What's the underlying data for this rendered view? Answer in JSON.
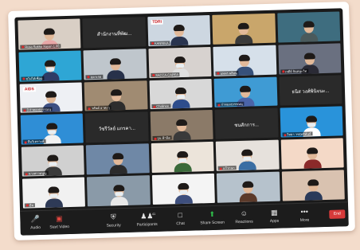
{
  "tiles": [
    {
      "kind": "person",
      "bg": "#d9cfc5",
      "torso": "#e8a7a7",
      "name": "Rusa Sokha Sayan 1.00"
    },
    {
      "kind": "text",
      "bg": "#2a2a2a",
      "label": "สำนักงานที่พัฒ..."
    },
    {
      "kind": "person",
      "bg": "#cdd7e1",
      "torso": "#29344f",
      "name": "KANNIKA",
      "tag": "TDRI",
      "tag_color": "red"
    },
    {
      "kind": "person",
      "bg": "#c9a66b",
      "torso": "#3a3a3a",
      "name": ""
    },
    {
      "kind": "person",
      "bg": "#3e6d7f",
      "torso": "#4a5a5c",
      "name": ""
    },
    {
      "kind": "person",
      "bg": "#2ea6d5",
      "torso": "#2e3c66",
      "name": "ชไม่ได้เชื่อม",
      "mask": true
    },
    {
      "kind": "person",
      "bg": "#bfc6cc",
      "torso": "#27314a",
      "name": "ฤดาเรต"
    },
    {
      "kind": "person",
      "bg": "#d7d2cf",
      "torso": "#e0e0e0",
      "name": "SACCA-CAPEA",
      "mask": true
    },
    {
      "kind": "person",
      "bg": "#d6e0ea",
      "torso": "#37517a",
      "name": "นพพร ผลิอนุ"
    },
    {
      "kind": "person",
      "bg": "#6a7080",
      "torso": "#2a2a35",
      "name": "เจดีย์ จินทนะวิท"
    },
    {
      "kind": "person",
      "bg": "#eef0f4",
      "torso": "#3d4f82",
      "name": "3 ก่าตองสุวรรณนุ",
      "tag": "AIDS"
    },
    {
      "kind": "person",
      "bg": "#a08b72",
      "torso": "#2d2d2d",
      "name": "วสันต์ อาคะวุ"
    },
    {
      "kind": "person",
      "bg": "#d8d8d8",
      "torso": "#2e4d8c",
      "name": "Chalinee",
      "mask": true
    },
    {
      "kind": "person",
      "bg": "#3f9bd4",
      "torso": "#4b64a8",
      "name": "ก่าตองสุวรรณนุ"
    },
    {
      "kind": "text",
      "bg": "#2a2a2a",
      "label": "ธนิส วงศ์พินิจนะ..."
    },
    {
      "kind": "person",
      "bg": "#2f8ed6",
      "torso": "#f2f2f2",
      "name": "ทีมวิเคราะห์",
      "mask": true
    },
    {
      "kind": "text",
      "bg": "#2a2a2a",
      "label": "วัชรีวัลย์ แกรคา..."
    },
    {
      "kind": "person",
      "bg": "#8b7a68",
      "torso": "#3a3a3a",
      "name": "จูน ฟ้านิด"
    },
    {
      "kind": "text",
      "bg": "#2a2a2a",
      "label": "ชนสักการ..."
    },
    {
      "kind": "person",
      "bg": "#2993da",
      "torso": "#ffffff",
      "name": "วิทยา วรสุทธิพันธ์",
      "mask": true
    },
    {
      "kind": "person",
      "bg": "#d0d0d0",
      "torso": "#3a3a3a",
      "name": "นางสาวมนูญ",
      "mask": true
    },
    {
      "kind": "person",
      "bg": "#6f88a6",
      "torso": "#2b2b2b",
      "name": ""
    },
    {
      "kind": "person",
      "bg": "#ece4da",
      "torso": "#3a6a3a",
      "name": "",
      "mask": true
    },
    {
      "kind": "person",
      "bg": "#e6e1dc",
      "torso": "#3b6ea3",
      "name": "แก้วกนก",
      "mask": true
    },
    {
      "kind": "person",
      "bg": "#f4d9c7",
      "torso": "#8b2a2a",
      "name": ""
    },
    {
      "kind": "person",
      "bg": "#f1f1f1",
      "torso": "#2e3a56",
      "name": "มีช",
      "mask": true
    },
    {
      "kind": "person",
      "bg": "#8a9aa8",
      "torso": "#e8e8e8",
      "name": "",
      "mask": true
    },
    {
      "kind": "person",
      "bg": "#f4f4f4",
      "torso": "#3e4f7d",
      "name": "",
      "mask": true
    },
    {
      "kind": "person",
      "bg": "#b6c2cc",
      "torso": "#5c3a2a",
      "name": ""
    },
    {
      "kind": "person",
      "bg": "#d9c2b0",
      "torso": "#2a3a5a",
      "name": ""
    }
  ],
  "toolbar": {
    "audio": {
      "label": "Audio",
      "icon": "microphone-icon"
    },
    "video": {
      "label": "Start Video",
      "icon": "video-camera-icon"
    },
    "security": {
      "label": "Security",
      "icon": "shield-icon"
    },
    "participants": {
      "label": "Participants",
      "count": "41",
      "icon": "participants-icon"
    },
    "chat": {
      "label": "Chat",
      "icon": "chat-icon"
    },
    "share": {
      "label": "Share Screen",
      "icon": "share-screen-icon"
    },
    "reactions": {
      "label": "Reactions",
      "icon": "reactions-icon"
    },
    "apps": {
      "label": "Apps",
      "icon": "apps-icon"
    },
    "more": {
      "label": "More",
      "icon": "more-icon"
    },
    "end": {
      "label": "End"
    }
  },
  "colors": {
    "background": "#f3dccb",
    "toolbar": "#1c1c1c",
    "share_green": "#2fbe4a",
    "end_red": "#d73a3a",
    "muted_red": "#e02b2b"
  }
}
